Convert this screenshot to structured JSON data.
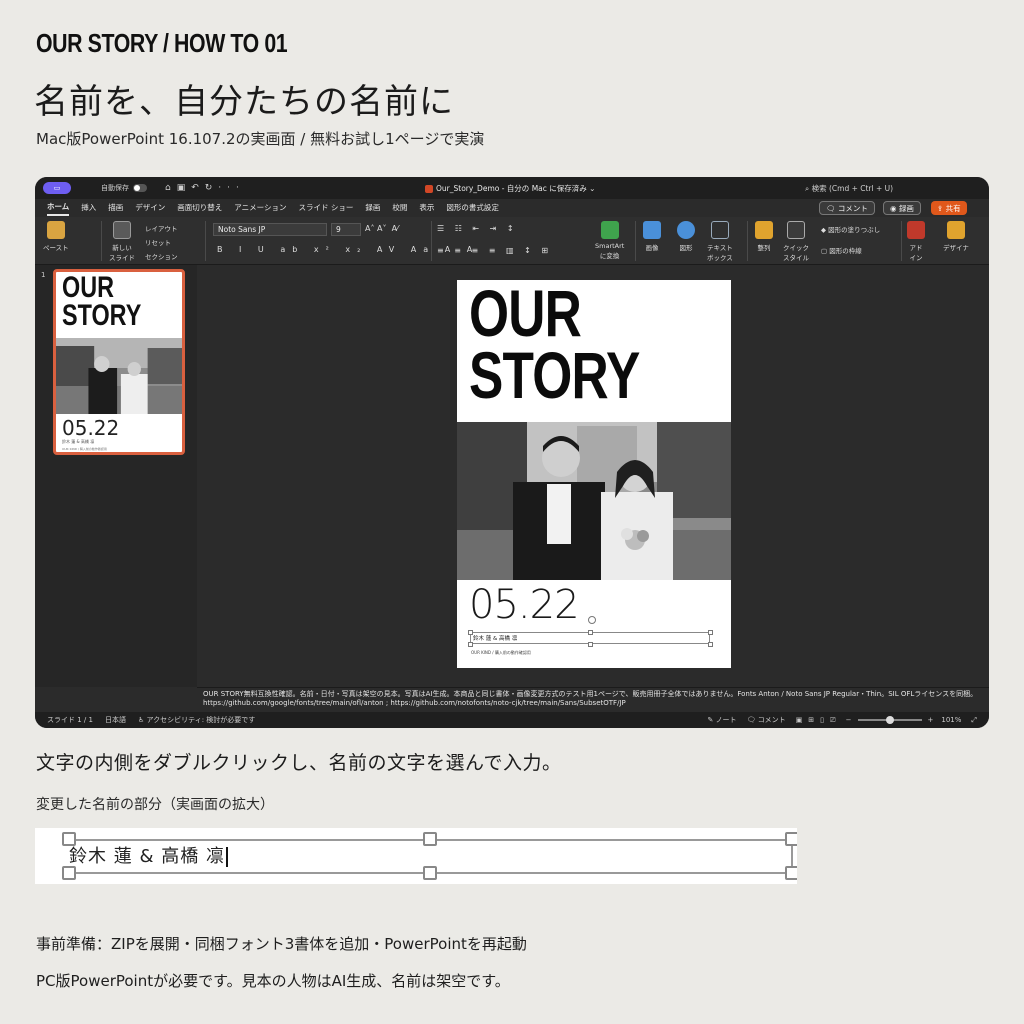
{
  "header": {
    "series": "OUR STORY / HOW TO 01",
    "title": "名前を、自分たちの名前に",
    "subtitle": "Mac版PowerPoint 16.107.2の実画面 / 無料お試し1ページで実演"
  },
  "window": {
    "autosave_label": "自動保存",
    "doc_title": "Our_Story_Demo - 自分の Mac に保存済み ⌄",
    "search_placeholder": "検索 (Cmd + Ctrl + U)",
    "menu_tabs": [
      "ホーム",
      "挿入",
      "描画",
      "デザイン",
      "画面切り替え",
      "アニメーション",
      "スライド ショー",
      "録画",
      "校閲",
      "表示",
      "図形の書式設定"
    ],
    "comment_button": "コメント",
    "record_button": "録画",
    "share_button": "共有",
    "ribbon": {
      "paste": "ペースト",
      "new_slide": "新しい\nスライド",
      "layout": "レイアウト",
      "reset": "リセット",
      "section": "セクション",
      "font_name": "Noto Sans JP",
      "font_size": "9",
      "smartart": "SmartArt\nに変換",
      "image": "画像",
      "shape": "図形",
      "textbox": "テキスト\nボックス",
      "arrange": "整列",
      "quick_style": "クイック\nスタイル",
      "shape_fill": "図形の塗りつぶし",
      "shape_outline": "図形の枠線",
      "addin": "アド\nイン",
      "designer": "デザイナ"
    },
    "slide_number": "1",
    "slide": {
      "title_line1": "OUR",
      "title_line2": "STORY",
      "date": "05.22",
      "names": "鈴木 蓮 & 高橋 凛",
      "small_text": "OUR KIND / 購入前の動作確認用"
    },
    "notes": "OUR STORY無料互換性確認。名前・日付・写真は架空の見本。写真はAI生成。本商品と同じ書体・画像変更方式のテスト用1ページで、販売用冊子全体ではありません。Fonts Anton / Noto Sans JP Regular・Thin。SIL OFLライセンスを同梱。https://github.com/google/fonts/tree/main/ofl/anton ; https://github.com/notofonts/noto-cjk/tree/main/Sans/SubsetOTF/JP",
    "status": {
      "slide": "スライド 1 / 1",
      "language": "日本語",
      "accessibility": "アクセシビリティ: 検討が必要です",
      "notes": "ノート",
      "comments": "コメント",
      "zoom": "101%"
    }
  },
  "instruction": "文字の内側をダブルクリックし、名前の文字を選んで入力。",
  "caption": "変更した名前の部分（実画面の拡大）",
  "zoomed_text": "鈴木 蓮 & 高橋 凛",
  "prep_note": "事前準備：ZIPを展開・同梱フォント3書体を追加・PowerPointを再起動",
  "requirement_note": "PC版PowerPointが必要です。見本の人物はAI生成、名前は架空です。",
  "colors": {
    "background": "#ebeae6",
    "window": "#2b2b2b",
    "share": "#e0581b",
    "thumb_border": "#d9603f"
  }
}
